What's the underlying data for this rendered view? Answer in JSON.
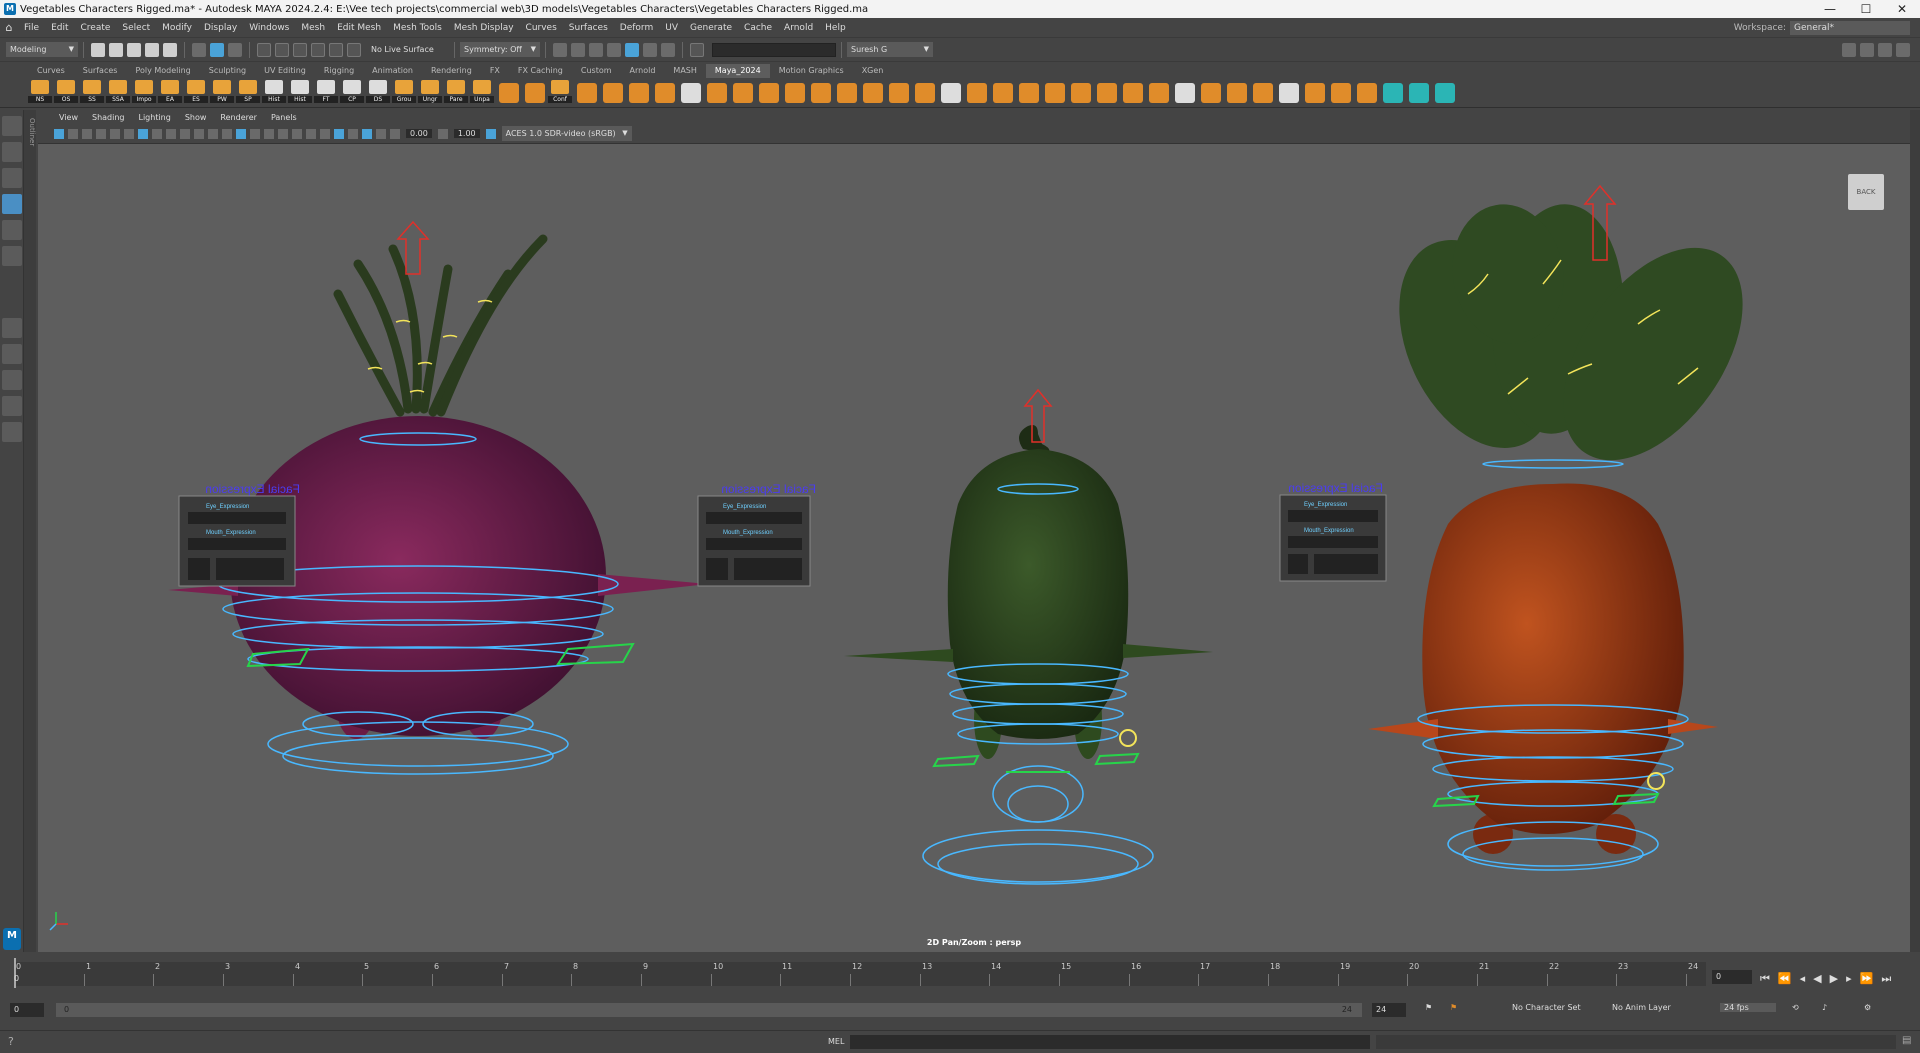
{
  "window": {
    "title": "Vegetables Characters Rigged.ma* - Autodesk MAYA 2024.2.4: E:\\Vee tech projects\\commercial web\\3D models\\Vegetables Characters\\Vegetables Characters Rigged.ma",
    "app_icon": "M",
    "minimize": "—",
    "maximize": "☐",
    "close": "✕"
  },
  "menus": [
    "File",
    "Edit",
    "Create",
    "Select",
    "Modify",
    "Display",
    "Windows",
    "Mesh",
    "Edit Mesh",
    "Mesh Tools",
    "Mesh Display",
    "Curves",
    "Surfaces",
    "Deform",
    "UV",
    "Generate",
    "Cache",
    "Arnold",
    "Help"
  ],
  "workspace": {
    "label": "Workspace:",
    "value": "General*"
  },
  "statusline": {
    "menuset": "Modeling",
    "live_surface": "No Live Surface",
    "symmetry": "Symmetry: Off",
    "user": "Suresh G"
  },
  "shelf_tabs": [
    "Curves",
    "Surfaces",
    "Poly Modeling",
    "Sculpting",
    "UV Editing",
    "Rigging",
    "Animation",
    "Rendering",
    "FX",
    "FX Caching",
    "Custom",
    "Arnold",
    "MASH",
    "Maya_2024",
    "Motion Graphics",
    "XGen"
  ],
  "active_shelf_tab": "Maya_2024",
  "shelf_buttons": [
    "NS",
    "OS",
    "SS",
    "SSA",
    "Impo",
    "EA",
    "ES",
    "PW",
    "SP",
    "Hist",
    "Hist",
    "FT",
    "CP",
    "DS",
    "Grou",
    "Ungr",
    "Pare",
    "Unpa",
    "Conf"
  ],
  "viewport_menu": [
    "View",
    "Shading",
    "Lighting",
    "Show",
    "Renderer",
    "Panels"
  ],
  "viewport_toolbar": {
    "exposure": "0.00",
    "gamma": "1.00",
    "color_space": "ACES 1.0 SDR-video (sRGB)"
  },
  "viewport": {
    "back_button": "BACK",
    "camera_label": "2D Pan/Zoom : persp",
    "panel_label": "Facial Expression",
    "panel_sub1": "Eye_Expression",
    "panel_sub2": "Mouth_Expression",
    "colors": {
      "background": "#5e5e5e",
      "onion": "#7a2150",
      "pepper": "#2e4a1f",
      "carrot": "#b8471b",
      "leaf": "#2f4a22",
      "control_blue": "#49b8ff",
      "control_green": "#27d44a",
      "control_yellow": "#f3e45a",
      "control_red": "#e0302a"
    }
  },
  "outliner_label": "Outliner",
  "timeslider": {
    "ticks": [
      "0",
      "1",
      "2",
      "3",
      "4",
      "5",
      "6",
      "7",
      "8",
      "9",
      "10",
      "11",
      "12",
      "13",
      "14",
      "15",
      "16",
      "17",
      "18",
      "19",
      "20",
      "21",
      "22",
      "23",
      "24"
    ],
    "current_frame": "0",
    "current_field": "0"
  },
  "rangeslider": {
    "start": "0",
    "inner_start": "0",
    "inner_end": "24",
    "end": "24",
    "character_set": "No Character Set",
    "anim_layer": "No Anim Layer",
    "fps": "24 fps"
  },
  "cmdline": {
    "mode": "MEL"
  }
}
